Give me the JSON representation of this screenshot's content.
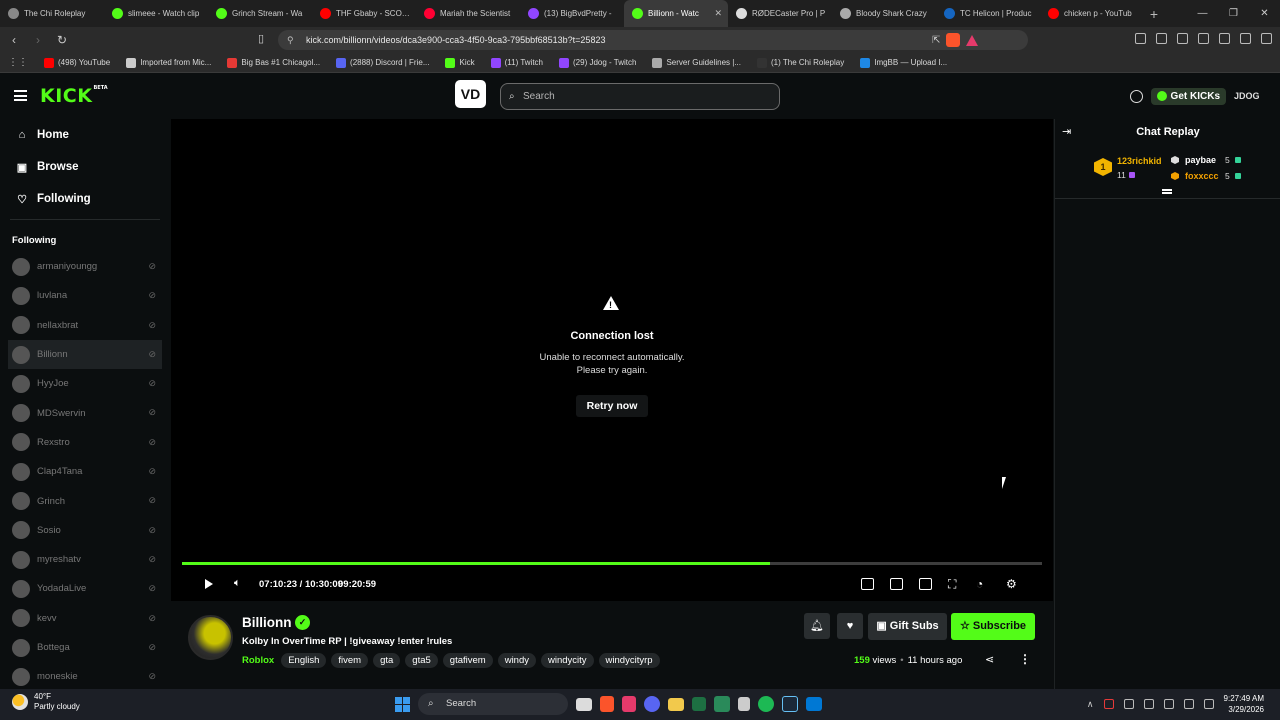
{
  "browser": {
    "tabs": [
      {
        "title": "The Chi Roleplay",
        "color": "#888888",
        "active": false
      },
      {
        "title": "slimeee - Watch clip",
        "color": "#53fc18",
        "active": false
      },
      {
        "title": "Grinch Stream - Wa",
        "color": "#53fc18",
        "active": false
      },
      {
        "title": "THF Gbaby - SCOOP",
        "color": "#ff0000",
        "active": false
      },
      {
        "title": "Mariah the Scientist",
        "color": "#ff0033",
        "active": false
      },
      {
        "title": "(13) BigBvdPretty -",
        "color": "#9146ff",
        "active": false
      },
      {
        "title": "Billionn - Watc",
        "color": "#53fc18",
        "active": true
      },
      {
        "title": "RØDECaster Pro | P",
        "color": "#dddddd",
        "active": false
      },
      {
        "title": "Bloody Shark Crazy",
        "color": "#aaaaaa",
        "active": false
      },
      {
        "title": "TC Helicon | Produc",
        "color": "#1565c0",
        "active": false
      },
      {
        "title": "chicken p - YouTub",
        "color": "#ff0000",
        "active": false
      }
    ],
    "new_tab": "+",
    "url": "kick.com/billionn/videos/dca3e900-cca3-4f50-9ca3-795bbf68513b?t=25823",
    "bookmarks": [
      {
        "label": "(498) YouTube",
        "color": "#ff0000"
      },
      {
        "label": "Imported from Mic...",
        "color": "#cccccc"
      },
      {
        "label": "Big Bas #1 Chicagol...",
        "color": "#e53935"
      },
      {
        "label": "(2888) Discord | Frie...",
        "color": "#5865f2"
      },
      {
        "label": "Kick",
        "color": "#53fc18"
      },
      {
        "label": "(11) Twitch",
        "color": "#9146ff"
      },
      {
        "label": "(29) Jdog - Twitch",
        "color": "#9146ff"
      },
      {
        "label": "Server Guidelines |...",
        "color": "#aaaaaa"
      },
      {
        "label": "(1) The Chi Roleplay",
        "color": "#333333"
      },
      {
        "label": "ImgBB — Upload I...",
        "color": "#1e88e5"
      }
    ]
  },
  "header": {
    "logo": "KICK",
    "logo_tag": "BETA",
    "vod_icon_text": "VD",
    "search_placeholder": "Search",
    "get_kicks": "Get KICKs",
    "user_badge": "JDOG"
  },
  "sidebar": {
    "nav": [
      {
        "label": "Home",
        "icon": "⌂"
      },
      {
        "label": "Browse",
        "icon": "▣"
      },
      {
        "label": "Following",
        "icon": "♡"
      }
    ],
    "following_title": "Following",
    "channels": [
      {
        "name": "armaniyoungg",
        "selected": false
      },
      {
        "name": "luvlana",
        "selected": false
      },
      {
        "name": "nellaxbrat",
        "selected": false
      },
      {
        "name": "Billionn",
        "selected": true
      },
      {
        "name": "HyyJoe",
        "selected": false
      },
      {
        "name": "MDSwervin",
        "selected": false
      },
      {
        "name": "Rexstro",
        "selected": false
      },
      {
        "name": "Clap4Tana",
        "selected": false
      },
      {
        "name": "Grinch",
        "selected": false
      },
      {
        "name": "Sosio",
        "selected": false
      },
      {
        "name": "myreshatv",
        "selected": false
      },
      {
        "name": "YodadaLive",
        "selected": false
      },
      {
        "name": "kevv",
        "selected": false
      },
      {
        "name": "Bottega",
        "selected": false
      },
      {
        "name": "moneskie",
        "selected": false
      }
    ]
  },
  "player": {
    "error_title": "Connection lost",
    "error_message": "Unable to reconnect automatically.\nPlease try again.",
    "retry_label": "Retry now",
    "time_current": "07:10:23",
    "time_separator": "/",
    "time_total": "10:30:09",
    "time_elapsed_marker": "09:20:59",
    "progress_fraction": 0.6833
  },
  "chat": {
    "title": "Chat Replay",
    "leaderboard": [
      {
        "rank": "1",
        "name": "123richkid",
        "count": "11",
        "color": "#f2b400"
      },
      {
        "name": "paybae",
        "count": "5",
        "color": "#ffffff"
      },
      {
        "name": "foxxccc",
        "count": "5",
        "color": "#f2a100"
      }
    ]
  },
  "stream_info": {
    "channel_name": "Billionn",
    "title": "Kolby In OverTime RP | !giveaway !enter !rules",
    "category": "Roblox",
    "tags": [
      "English",
      "fivem",
      "gta",
      "gta5",
      "gtafivem",
      "windy",
      "windycity",
      "windycityrp"
    ],
    "views_count": "159",
    "views_label": "views",
    "age": "11 hours ago",
    "gift_subs_label": "Gift Subs",
    "subscribe_label": "Subscribe"
  },
  "taskbar": {
    "temperature": "40°F",
    "weather": "Partly cloudy",
    "search_label": "Search",
    "time": "9:27:49 AM",
    "date": "3/29/2026"
  }
}
